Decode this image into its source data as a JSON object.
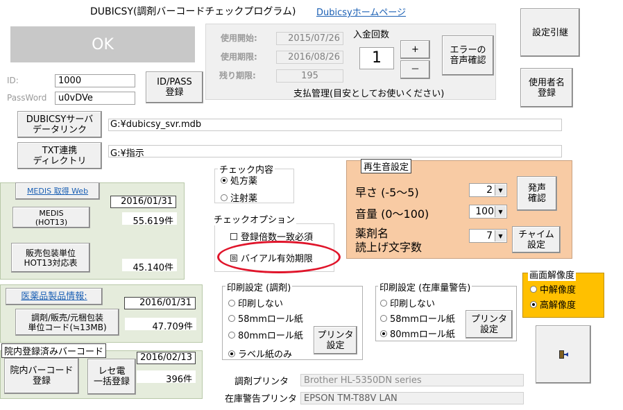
{
  "app": {
    "title": "DUBICSY(調剤バーコードチェックプログラム)",
    "homepage_link": "Dubicsyホームページ"
  },
  "status": {
    "ok_text": "OK"
  },
  "login": {
    "id_label": "ID:",
    "id_value": "1000",
    "pass_label": "PassWord",
    "pass_value": "u0vDVe",
    "register_button": "ID/PASS\n登録"
  },
  "usage": {
    "start_label": "使用開始:",
    "start_value": "2015/07/26",
    "end_label": "使用期限:",
    "end_value": "2016/08/26",
    "remain_label": "残り期限:",
    "remain_value": "195",
    "payment_count_label": "入金回数",
    "payment_count_value": "1",
    "plus": "+",
    "minus": "－",
    "payment_note": "支払管理(目安としてお使いください)"
  },
  "buttons": {
    "error_sound": "エラーの\n音声確認",
    "settings_inherit": "設定引継",
    "user_register": "使用者名\n登録",
    "server_link": "DUBICSYサーバ\nデータリンク",
    "txt_link": "TXT連携\nディレクトリ",
    "exit_icon": "exit-icon"
  },
  "paths": {
    "server_path": "G:¥dubicsy_svr.mdb",
    "txt_path": "G:¥指示"
  },
  "medis": {
    "web_link": "MEDIS 取得 Web",
    "date": "2016/01/31",
    "hot13_button": "MEDIS\n(HOT13)",
    "hot13_count": "55,619件",
    "sales_button": "販売包装単位\nHOT13対応表",
    "sales_count": "45,140件"
  },
  "drug_info": {
    "link": "医薬品製品情報:",
    "date": "2016/01/31",
    "code_button": "調剤/販売/元梱包装\n単位コード(≒13MB)",
    "code_count": "47,709件"
  },
  "hospital": {
    "title": "院内登録済みバーコード",
    "date": "2016/02/13",
    "count": "396件",
    "barcode_button": "院内バーコード\n登録",
    "rece_button": "レセ電\n一括登録"
  },
  "check_content": {
    "title": "チェック内容",
    "options": [
      "処方薬",
      "注射薬"
    ],
    "selected": "処方薬"
  },
  "check_options": {
    "title": "チェックオプション",
    "items": [
      "登録倍数一致必須",
      "バイアル有効期限"
    ]
  },
  "sound": {
    "title": "再生音設定",
    "speed_label": "早さ (-5～5)",
    "speed_value": "2",
    "volume_label": "音量 (0～100)",
    "volume_value": "100",
    "chars_label": "薬剤名\n読上げ文字数",
    "chars_value": "7",
    "sound_confirm": "発声\n確認",
    "chime_button": "チャイム\n設定",
    "panel_color": "#f8cba4"
  },
  "print_dispense": {
    "title": "印刷設定 (調剤)",
    "options": [
      "印刷しない",
      "58mmロール紙",
      "80mmロール紙",
      "ラベル紙のみ"
    ],
    "selected": "ラベル紙のみ",
    "printer_button": "プリンタ\n設定"
  },
  "print_stock": {
    "title": "印刷設定 (在庫量警告)",
    "options": [
      "印刷しない",
      "58mmロール紙",
      "80mmロール紙"
    ],
    "selected": "80mmロール紙",
    "printer_button": "プリンタ\n設定"
  },
  "resolution": {
    "title": "画面解像度",
    "options": [
      "中解像度",
      "高解像度"
    ],
    "selected": "高解像度",
    "panel_color": "#ffc000"
  },
  "printers": {
    "dispense_label": "調剤プリンタ",
    "dispense_value": "Brother HL-5350DN series",
    "stock_label": "在庫警告プリンタ",
    "stock_value": "EPSON TM-T88V LAN"
  }
}
